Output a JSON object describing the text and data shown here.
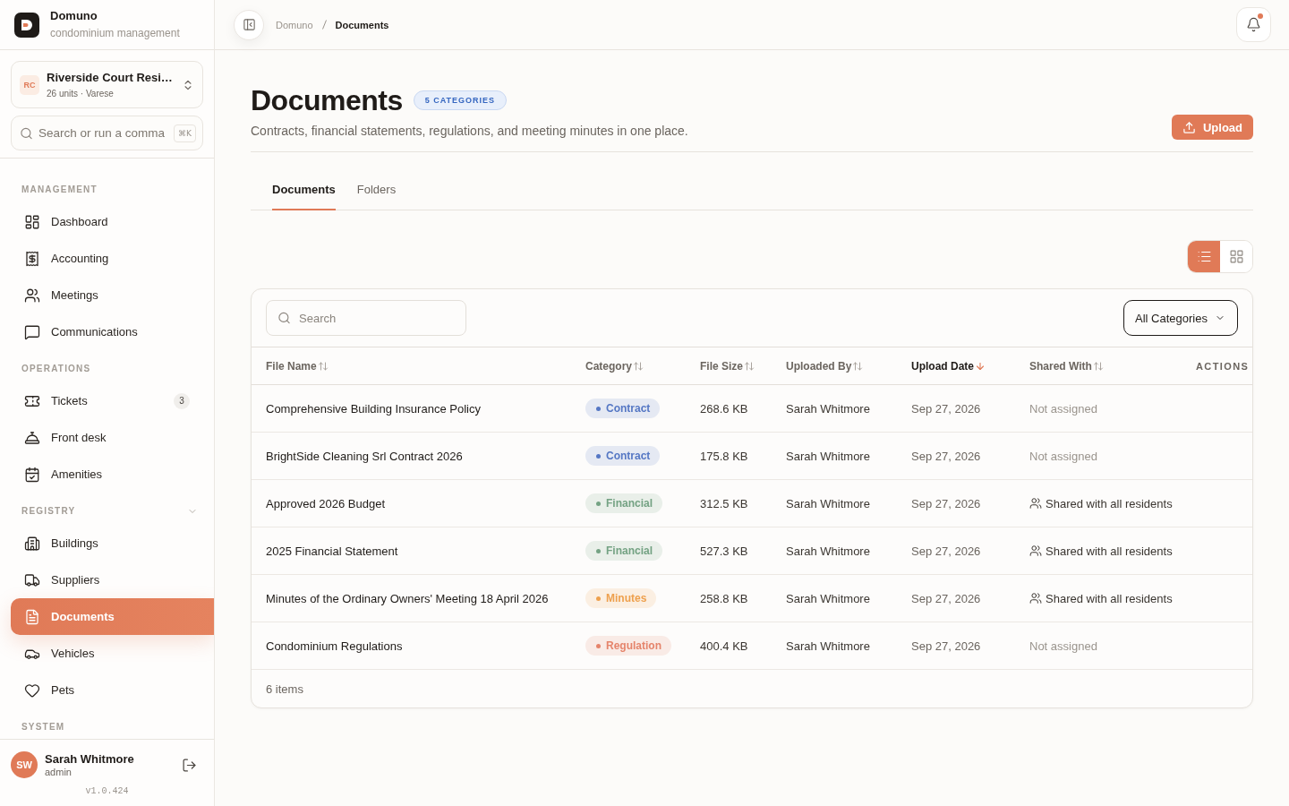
{
  "brand": {
    "name": "Domuno",
    "tagline": "condominium management"
  },
  "property": {
    "initials": "RC",
    "name": "Riverside Court Resi…",
    "details": "26 units · Varese"
  },
  "command_search": {
    "placeholder": "Search or run a comma",
    "shortcut": "⌘K"
  },
  "sidebar": {
    "sections": [
      {
        "title": "MANAGEMENT",
        "items": [
          {
            "label": "Dashboard",
            "selected": false
          },
          {
            "label": "Accounting",
            "selected": false
          },
          {
            "label": "Meetings",
            "selected": false
          },
          {
            "label": "Communications",
            "selected": false
          }
        ]
      },
      {
        "title": "OPERATIONS",
        "items": [
          {
            "label": "Tickets",
            "badge": "3",
            "selected": false
          },
          {
            "label": "Front desk",
            "selected": false
          },
          {
            "label": "Amenities",
            "selected": false
          }
        ]
      },
      {
        "title": "REGISTRY",
        "expanded": true,
        "items": [
          {
            "label": "Buildings",
            "selected": false
          },
          {
            "label": "Suppliers",
            "selected": false
          },
          {
            "label": "Documents",
            "selected": true
          },
          {
            "label": "Vehicles",
            "selected": false
          },
          {
            "label": "Pets",
            "selected": false
          }
        ]
      },
      {
        "title": "SYSTEM"
      }
    ]
  },
  "sidebar_footer": {
    "user": {
      "initials": "SW",
      "name": "Sarah Whitmore",
      "role": "admin"
    },
    "version": "v1.0.424"
  },
  "topbar": {
    "breadcrumbs": [
      "Domuno",
      "Documents"
    ],
    "notifications": {
      "unread": true
    }
  },
  "page": {
    "title": "Documents",
    "badge": "5 CATEGORIES",
    "subtitle": "Contracts, financial statements, regulations, and meeting minutes in one place.",
    "upload_button": "Upload"
  },
  "tabs": [
    {
      "label": "Documents",
      "selected": true
    },
    {
      "label": "Folders",
      "selected": false
    }
  ],
  "view_toggle": [
    {
      "selected": true
    },
    {
      "selected": false
    }
  ],
  "table": {
    "search": {
      "placeholder": "Search"
    },
    "filter": "All Categories",
    "columns": [
      {
        "label": "File Name",
        "sorted": false
      },
      {
        "label": "Category",
        "sorted": false
      },
      {
        "label": "File Size",
        "sorted": false
      },
      {
        "label": "Uploaded By",
        "sorted": false
      },
      {
        "label": "Upload Date",
        "sorted": true
      },
      {
        "label": "Shared With",
        "sorted": false
      },
      {
        "label": "ACTIONS"
      }
    ],
    "rows": [
      {
        "file_name": "Comprehensive Building Insurance Policy",
        "category": {
          "label": "Contract",
          "color": "#5577c4"
        },
        "file_size": "268.6 KB",
        "uploaded_by": "Sarah Whitmore",
        "upload_date": "Sep 27, 2026",
        "shared_with": {
          "label": "Not assigned",
          "shared": false
        }
      },
      {
        "file_name": "BrightSide Cleaning Srl Contract 2026",
        "category": {
          "label": "Contract",
          "color": "#5577c4"
        },
        "file_size": "175.8 KB",
        "uploaded_by": "Sarah Whitmore",
        "upload_date": "Sep 27, 2026",
        "shared_with": {
          "label": "Not assigned",
          "shared": false
        }
      },
      {
        "file_name": "Approved 2026 Budget",
        "category": {
          "label": "Financial",
          "color": "#74a283"
        },
        "file_size": "312.5 KB",
        "uploaded_by": "Sarah Whitmore",
        "upload_date": "Sep 27, 2026",
        "shared_with": {
          "label": "Shared with all residents",
          "shared": true
        }
      },
      {
        "file_name": "2025 Financial Statement",
        "category": {
          "label": "Financial",
          "color": "#74a283"
        },
        "file_size": "527.3 KB",
        "uploaded_by": "Sarah Whitmore",
        "upload_date": "Sep 27, 2026",
        "shared_with": {
          "label": "Shared with all residents",
          "shared": true
        }
      },
      {
        "file_name": "Minutes of the Ordinary Owners' Meeting 18 April 2026",
        "category": {
          "label": "Minutes",
          "color": "#eea04d"
        },
        "file_size": "258.8 KB",
        "uploaded_by": "Sarah Whitmore",
        "upload_date": "Sep 27, 2026",
        "shared_with": {
          "label": "Shared with all residents",
          "shared": true
        }
      },
      {
        "file_name": "Condominium Regulations",
        "category": {
          "label": "Regulation",
          "color": "#e5846b"
        },
        "file_size": "400.4 KB",
        "uploaded_by": "Sarah Whitmore",
        "upload_date": "Sep 27, 2026",
        "shared_with": {
          "label": "Not assigned",
          "shared": false
        }
      }
    ],
    "footer": "6 items"
  }
}
